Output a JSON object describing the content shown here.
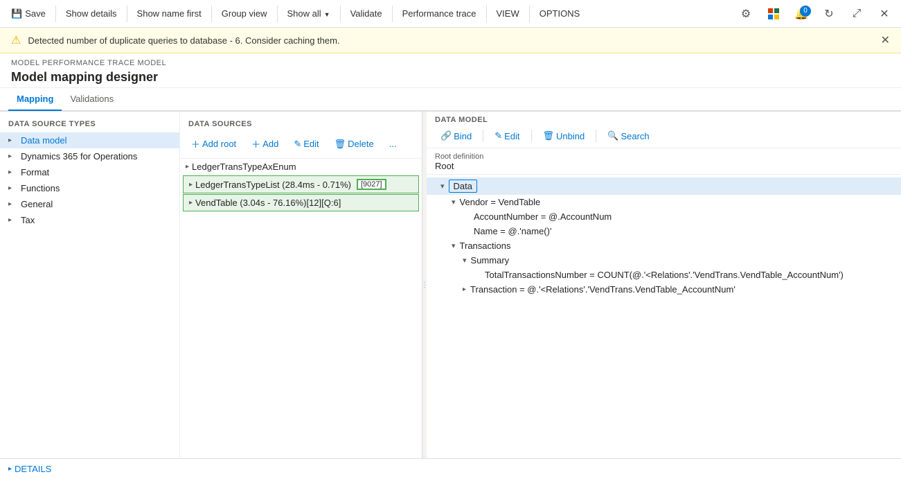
{
  "toolbar": {
    "save_label": "Save",
    "show_details_label": "Show details",
    "show_name_first_label": "Show name first",
    "group_view_label": "Group view",
    "show_all_label": "Show all",
    "validate_label": "Validate",
    "performance_trace_label": "Performance trace",
    "view_label": "VIEW",
    "options_label": "OPTIONS"
  },
  "warning": {
    "message": "Detected number of duplicate queries to database - 6. Consider caching them."
  },
  "breadcrumb": "MODEL PERFORMANCE TRACE MODEL",
  "page_title": "Model mapping designer",
  "tabs": {
    "mapping_label": "Mapping",
    "validations_label": "Validations"
  },
  "ds_types": {
    "header": "DATA SOURCE TYPES",
    "items": [
      {
        "label": "Data model",
        "selected": true
      },
      {
        "label": "Dynamics 365 for Operations",
        "selected": false
      },
      {
        "label": "Format",
        "selected": false
      },
      {
        "label": "Functions",
        "selected": false
      },
      {
        "label": "General",
        "selected": false
      },
      {
        "label": "Tax",
        "selected": false
      }
    ]
  },
  "ds_sources": {
    "header": "DATA SOURCES",
    "add_root_label": "Add root",
    "add_label": "Add",
    "edit_label": "Edit",
    "delete_label": "Delete",
    "more_label": "...",
    "items": [
      {
        "label": "LedgerTransTypeAxEnum",
        "highlighted": false
      },
      {
        "label": "LedgerTransTypeList (28.4ms - 0.71%)",
        "badge": "9027",
        "highlighted": true
      },
      {
        "label": "VendTable (3.04s - 76.16%)[12][Q:6]",
        "highlighted": true
      }
    ]
  },
  "data_model": {
    "header": "DATA MODEL",
    "bind_label": "Bind",
    "edit_label": "Edit",
    "unbind_label": "Unbind",
    "search_label": "Search",
    "root_definition_label": "Root definition",
    "root_value": "Root",
    "tree": [
      {
        "label": "Data",
        "indent": 0,
        "expanded": true,
        "selected": true,
        "type": "folder"
      },
      {
        "label": "Vendor = VendTable",
        "indent": 1,
        "expanded": true,
        "type": "folder"
      },
      {
        "label": "AccountNumber = @.AccountNum",
        "indent": 2,
        "expanded": false,
        "type": "leaf"
      },
      {
        "label": "Name = @.'name()'",
        "indent": 2,
        "expanded": false,
        "type": "leaf"
      },
      {
        "label": "Transactions",
        "indent": 1,
        "expanded": true,
        "type": "folder"
      },
      {
        "label": "Summary",
        "indent": 2,
        "expanded": true,
        "type": "folder"
      },
      {
        "label": "TotalTransactionsNumber = COUNT(@.'<Relations'.'VendTrans.VendTable_AccountNum')",
        "indent": 3,
        "expanded": false,
        "type": "leaf"
      },
      {
        "label": "Transaction = @.'<Relations'.'VendTrans.VendTable_AccountNum'",
        "indent": 2,
        "expanded": false,
        "type": "folder"
      }
    ]
  },
  "details": {
    "label": "DETAILS"
  }
}
